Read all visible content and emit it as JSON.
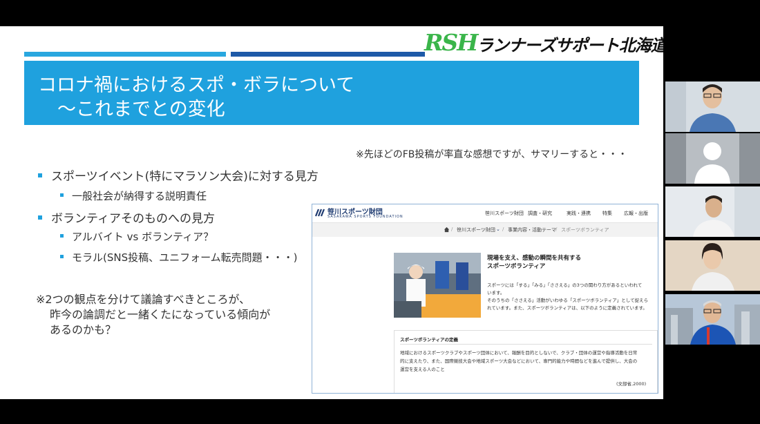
{
  "logo": {
    "mark": "RSH",
    "text": "ランナーズサポート北海道"
  },
  "title": {
    "line1": "コロナ禍におけるスポ・ボラについて",
    "line2": "〜これまでとの変化"
  },
  "note": "※先ほどのFB投稿が率直な感想ですが、サマリーすると・・・",
  "bullets": [
    {
      "text": "スポーツイベント(特にマラソン大会)に対する見方",
      "sub": [
        "一般社会が納得する説明責任"
      ]
    },
    {
      "text": "ボランティアそのものへの見方",
      "sub": [
        "アルバイト vs ボランティア？",
        "モラル(SNS投稿、ユニフォーム転売問題・・・)"
      ]
    }
  ],
  "remark": [
    "※2つの観点を分けて議論すべきところが、",
    "昨今の論調だと一緒くたになっている傾向が",
    "あるのかも？"
  ],
  "web": {
    "org_name": "笹川スポーツ財団",
    "org_sub": "SASAKAWA SPORTS FOUNDATION",
    "nav": [
      "笹川スポーツ財団",
      "調査・研究",
      "実践・連携",
      "特集",
      "広報・出版"
    ],
    "breadcrumb": [
      "笹川スポーツ財団",
      "事業内容・活動テーマ",
      "スポーツボランティア"
    ],
    "headline": [
      "現場を支え、感動の瞬間を共有する",
      "スポーツボランティア"
    ],
    "paragraph": [
      "スポーツには「する」「みる」「ささえる」の3つの関わり方があるといわれて",
      "います。",
      "そのうちの「ささえる」活動がいわゆる「スポーツボランティア」として捉えら",
      "れています。また、スポーツボランティアは、以下のように定義されています。"
    ],
    "definition_title": "スポーツボランティアの定義",
    "definition_body": [
      "地域におけるスポーツクラブやスポーツ団体において、報酬を目的としないで、クラブ・団体の運営や指導活動を日常",
      "的に支えたり、また、国際競技大会や地域スポーツ大会などにおいて、専門的能力や時間などを進んで提供し、大会の",
      "運営を支える人のこと"
    ],
    "definition_source": "(文部省,2000)"
  },
  "colors": {
    "accent": "#1fa1de",
    "dark_accent": "#1e5aa8",
    "logo_green": "#3ab54a"
  }
}
